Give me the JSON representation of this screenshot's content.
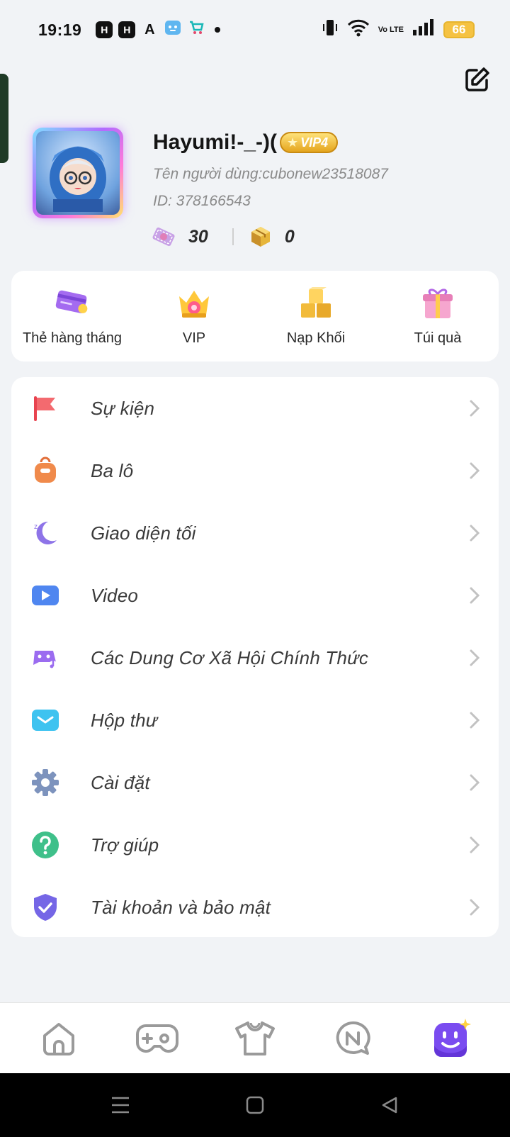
{
  "status_bar": {
    "time": "19:19",
    "app_icons": [
      "H",
      "H",
      "A"
    ],
    "battery": "66",
    "network": "Vo LTE"
  },
  "profile": {
    "name": "Hayumi!-_-)(",
    "vip_label": "VIP4",
    "username_line": "Tên người dùng:cubonew23518087",
    "id_line": "ID: 378166543",
    "tickets": "30",
    "blocks": "0"
  },
  "quick_actions": [
    {
      "label": "Thẻ hàng tháng",
      "icon": "monthly-card-icon"
    },
    {
      "label": "VIP",
      "icon": "crown-icon"
    },
    {
      "label": "Nạp Khối",
      "icon": "gold-blocks-icon"
    },
    {
      "label": "Túi quà",
      "icon": "gift-box-icon"
    }
  ],
  "menu": [
    {
      "label": "Sự kiện",
      "icon": "flag-icon"
    },
    {
      "label": "Ba lô",
      "icon": "backpack-icon"
    },
    {
      "label": "Giao diện tối",
      "icon": "moon-icon"
    },
    {
      "label": "Video",
      "icon": "video-camera-icon"
    },
    {
      "label": "Các Dung Cơ Xã Hội Chính Thức",
      "icon": "social-media-icon"
    },
    {
      "label": "Hộp thư",
      "icon": "mail-icon"
    },
    {
      "label": "Cài đặt",
      "icon": "gear-icon"
    },
    {
      "label": "Trợ giúp",
      "icon": "help-icon"
    },
    {
      "label": "Tài khoản và bảo mật",
      "icon": "shield-icon"
    }
  ],
  "tabs": [
    "home-icon",
    "gamepad-icon",
    "shirt-icon",
    "news-icon",
    "profile-face-icon"
  ],
  "colors": {
    "accent_purple": "#7a4cf0",
    "vip_gold": "#e5a51e",
    "background": "#f1f3f6"
  }
}
